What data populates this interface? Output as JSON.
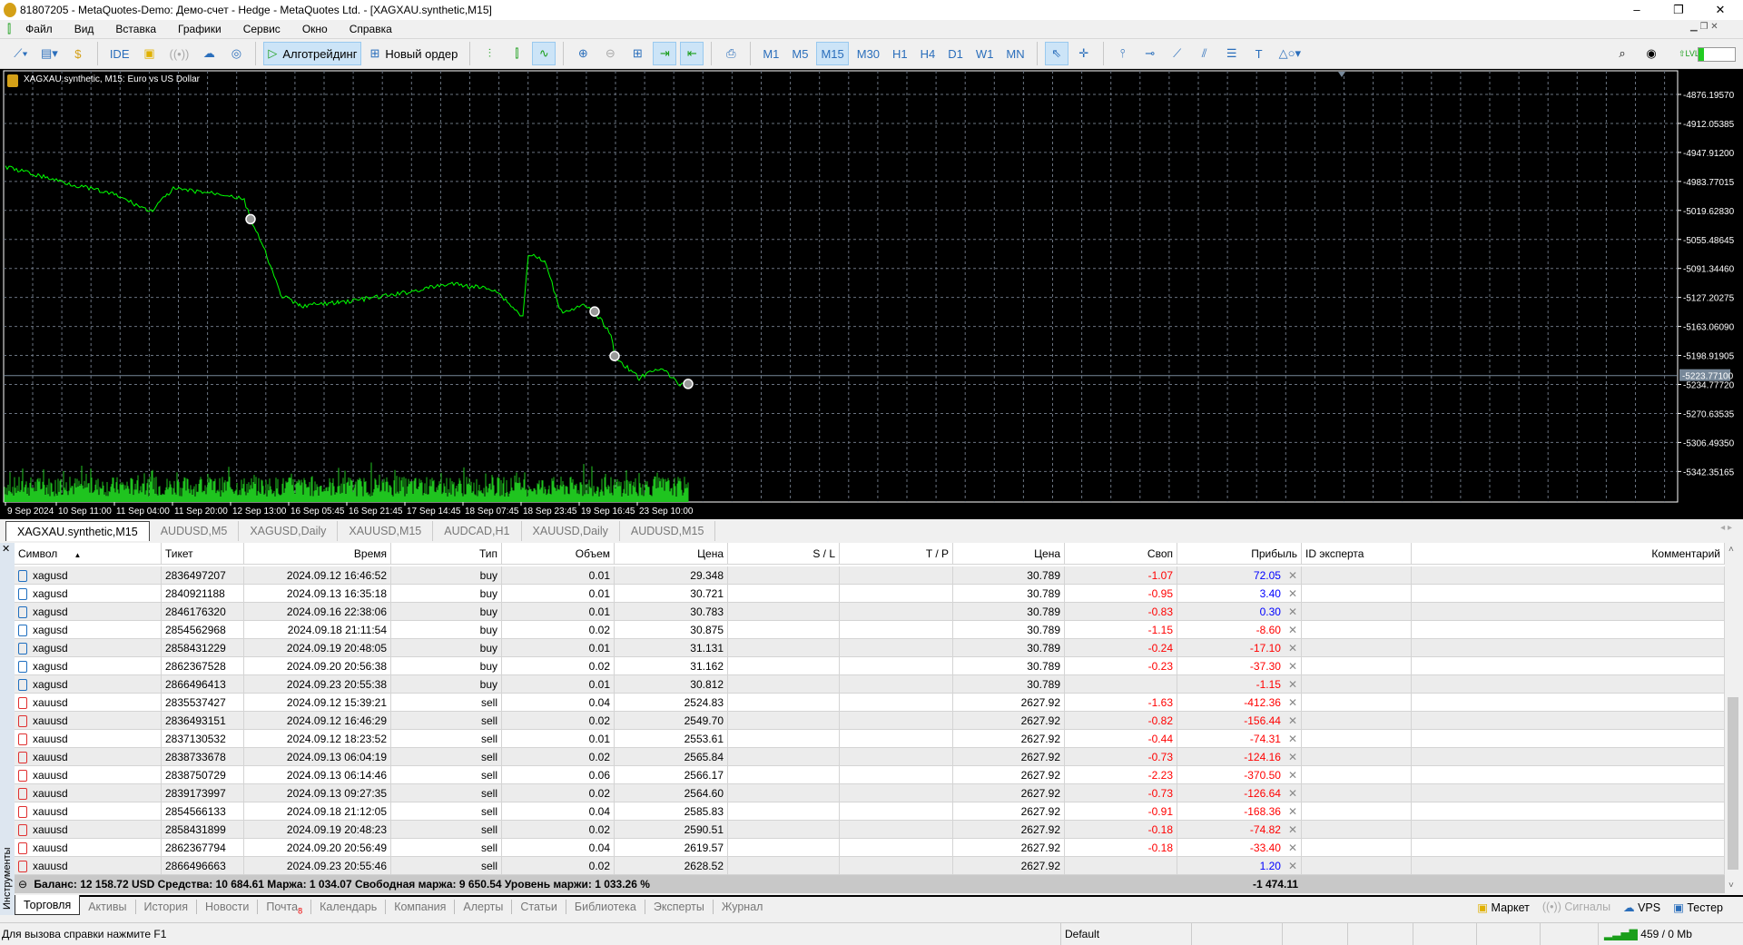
{
  "window": {
    "title": "81807205 - MetaQuotes-Demo: Демо-счет - Hedge - MetaQuotes Ltd. - [XAGXAU.synthetic,M15]",
    "min": "–",
    "max": "❐",
    "close": "✕"
  },
  "menu": [
    "Файл",
    "Вид",
    "Вставка",
    "Графики",
    "Сервис",
    "Окно",
    "Справка"
  ],
  "toolbar": {
    "ide": "IDE",
    "algotrading": "Алготрейдинг",
    "new_order": "Новый ордер",
    "timeframes": [
      "M1",
      "M5",
      "M15",
      "M30",
      "H1",
      "H4",
      "D1",
      "W1",
      "MN"
    ],
    "active_timeframe": "M15"
  },
  "chart": {
    "label": "XAGXAU.synthetic, M15:  Euro vs US Dollar",
    "price_labels": [
      "-4876.19570",
      "-4912.05385",
      "-4947.91200",
      "-4983.77015",
      "-5019.62830",
      "-5055.48645",
      "-5091.34460",
      "-5127.20275",
      "-5163.06090",
      "-5198.91905",
      "-5234.77720",
      "-5270.63535",
      "-5306.49350",
      "-5342.35165"
    ],
    "current_price": "-5223.77100",
    "time_labels": [
      "9 Sep 2024",
      "10 Sep 11:00",
      "11 Sep 04:00",
      "11 Sep 20:00",
      "12 Sep 13:00",
      "16 Sep 05:45",
      "16 Sep 21:45",
      "17 Sep 14:45",
      "18 Sep 07:45",
      "18 Sep 23:45",
      "19 Sep 16:45",
      "23 Sep 10:00"
    ],
    "line_color": "#00ff00",
    "background": "#000000",
    "price_series": [
      [
        0,
        -4965.7
      ],
      [
        70,
        -4986.3
      ],
      [
        120,
        -5000.1
      ],
      [
        160,
        -5020.7
      ],
      [
        185,
        -4993.2
      ],
      [
        245,
        -5000.1
      ],
      [
        263,
        -5007.0
      ],
      [
        270,
        -5030.4
      ],
      [
        288,
        -5075.8
      ],
      [
        303,
        -5124.0
      ],
      [
        324,
        -5137.7
      ],
      [
        367,
        -5133.6
      ],
      [
        428,
        -5124.0
      ],
      [
        490,
        -5110.2
      ],
      [
        539,
        -5117.1
      ],
      [
        570,
        -5151.5
      ],
      [
        576,
        -5073.0
      ],
      [
        594,
        -5082.7
      ],
      [
        612,
        -5144.6
      ],
      [
        637,
        -5137.7
      ],
      [
        649,
        -5144.6
      ],
      [
        667,
        -5172.1
      ],
      [
        671,
        -5199.7
      ],
      [
        698,
        -5227.2
      ],
      [
        722,
        -5213.4
      ],
      [
        741,
        -5234.1
      ],
      [
        752,
        -5234.1
      ]
    ],
    "markers": [
      [
        270,
        -5030.4
      ],
      [
        649,
        -5144.6
      ],
      [
        671,
        -5199.7
      ],
      [
        752,
        -5234.1
      ]
    ]
  },
  "symbol_tabs": [
    "XAGXAU.synthetic,M15",
    "AUDUSD,M5",
    "XAGUSD,Daily",
    "XAUUSD,M15",
    "AUDCAD,H1",
    "XAUUSD,Daily",
    "AUDUSD,M15"
  ],
  "table": {
    "headers": [
      "Символ",
      "Тикет",
      "Время",
      "Тип",
      "Объем",
      "Цена",
      "S / L",
      "T / P",
      "Цена",
      "Своп",
      "Прибыль",
      "ID эксперта",
      "Комментарий"
    ],
    "rows": [
      [
        "xagusd",
        "2836497207",
        "2024.09.12 16:46:52",
        "buy",
        "0.01",
        "29.348",
        "",
        "",
        "30.789",
        "-1.07",
        "72.05"
      ],
      [
        "xagusd",
        "2840921188",
        "2024.09.13 16:35:18",
        "buy",
        "0.01",
        "30.721",
        "",
        "",
        "30.789",
        "-0.95",
        "3.40"
      ],
      [
        "xagusd",
        "2846176320",
        "2024.09.16 22:38:06",
        "buy",
        "0.01",
        "30.783",
        "",
        "",
        "30.789",
        "-0.83",
        "0.30"
      ],
      [
        "xagusd",
        "2854562968",
        "2024.09.18 21:11:54",
        "buy",
        "0.02",
        "30.875",
        "",
        "",
        "30.789",
        "-1.15",
        "-8.60"
      ],
      [
        "xagusd",
        "2858431229",
        "2024.09.19 20:48:05",
        "buy",
        "0.01",
        "31.131",
        "",
        "",
        "30.789",
        "-0.24",
        "-17.10"
      ],
      [
        "xagusd",
        "2862367528",
        "2024.09.20 20:56:38",
        "buy",
        "0.02",
        "31.162",
        "",
        "",
        "30.789",
        "-0.23",
        "-37.30"
      ],
      [
        "xagusd",
        "2866496413",
        "2024.09.23 20:55:38",
        "buy",
        "0.01",
        "30.812",
        "",
        "",
        "30.789",
        "",
        "-1.15"
      ],
      [
        "xauusd",
        "2835537427",
        "2024.09.12 15:39:21",
        "sell",
        "0.04",
        "2524.83",
        "",
        "",
        "2627.92",
        "-1.63",
        "-412.36"
      ],
      [
        "xauusd",
        "2836493151",
        "2024.09.12 16:46:29",
        "sell",
        "0.02",
        "2549.70",
        "",
        "",
        "2627.92",
        "-0.82",
        "-156.44"
      ],
      [
        "xauusd",
        "2837130532",
        "2024.09.12 18:23:52",
        "sell",
        "0.01",
        "2553.61",
        "",
        "",
        "2627.92",
        "-0.44",
        "-74.31"
      ],
      [
        "xauusd",
        "2838733678",
        "2024.09.13 06:04:19",
        "sell",
        "0.02",
        "2565.84",
        "",
        "",
        "2627.92",
        "-0.73",
        "-124.16"
      ],
      [
        "xauusd",
        "2838750729",
        "2024.09.13 06:14:46",
        "sell",
        "0.06",
        "2566.17",
        "",
        "",
        "2627.92",
        "-2.23",
        "-370.50"
      ],
      [
        "xauusd",
        "2839173997",
        "2024.09.13 09:27:35",
        "sell",
        "0.02",
        "2564.60",
        "",
        "",
        "2627.92",
        "-0.73",
        "-126.64"
      ],
      [
        "xauusd",
        "2854566133",
        "2024.09.18 21:12:05",
        "sell",
        "0.04",
        "2585.83",
        "",
        "",
        "2627.92",
        "-0.91",
        "-168.36"
      ],
      [
        "xauusd",
        "2858431899",
        "2024.09.19 20:48:23",
        "sell",
        "0.02",
        "2590.51",
        "",
        "",
        "2627.92",
        "-0.18",
        "-74.82"
      ],
      [
        "xauusd",
        "2862367794",
        "2024.09.20 20:56:49",
        "sell",
        "0.04",
        "2619.57",
        "",
        "",
        "2627.92",
        "-0.18",
        "-33.40"
      ],
      [
        "xauusd",
        "2866496663",
        "2024.09.23 20:55:46",
        "sell",
        "0.02",
        "2628.52",
        "",
        "",
        "2627.92",
        "",
        "1.20"
      ]
    ],
    "close_glyph": "✕"
  },
  "balance": {
    "text": "Баланс: 12 158.72 USD  Средства: 10 684.61  Маржа: 1 034.07  Свободная маржа: 9 650.54  Уровень маржи: 1 033.26 %",
    "total": "-1 474.11"
  },
  "sidebar_label": "Инструменты",
  "bottom_tabs": [
    "Торговля",
    "Активы",
    "История",
    "Новости",
    "Почта",
    "Календарь",
    "Компания",
    "Алерты",
    "Статьи",
    "Библиотека",
    "Эксперты",
    "Журнал"
  ],
  "mail_badge": "8",
  "bottom_right": {
    "market": "Маркет",
    "signals": "Сигналы",
    "vps": "VPS",
    "tester": "Тестер"
  },
  "status": {
    "help": "Для вызова справки нажмите F1",
    "profile": "Default",
    "traffic": "459 / 0 Mb"
  },
  "colors": {
    "buy": "#1f6fc0",
    "sell": "#e03030",
    "negative": "#ff0000",
    "positive": "#0000ff",
    "active_button": "#cce4f7"
  }
}
